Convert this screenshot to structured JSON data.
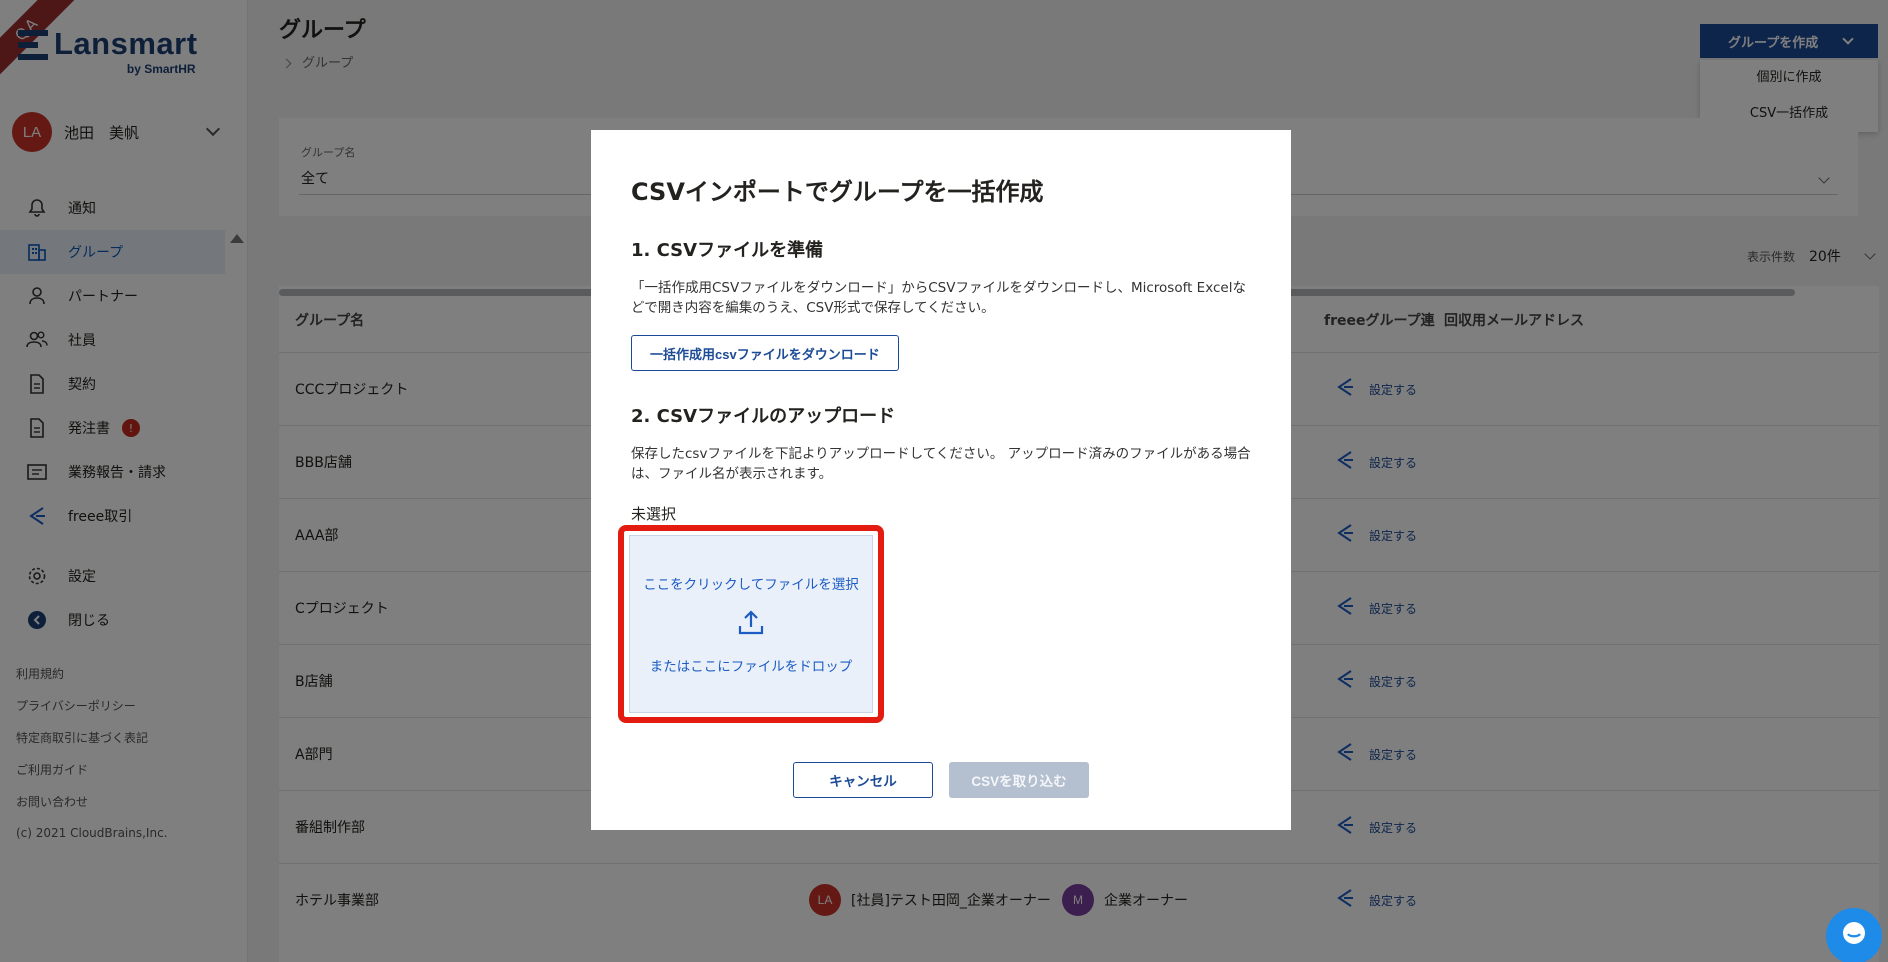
{
  "ribbon": "QA",
  "brand": {
    "name": "Lansmart",
    "sub": "by SmartHR",
    "color": "#1c3f74"
  },
  "user": {
    "initials": "LA",
    "name": "池田　美帆"
  },
  "nav": [
    {
      "label": "通知",
      "icon": "bell-icon"
    },
    {
      "label": "グループ",
      "icon": "building-icon",
      "active": true
    },
    {
      "label": "パートナー",
      "icon": "person-icon"
    },
    {
      "label": "社員",
      "icon": "people-icon"
    },
    {
      "label": "契約",
      "icon": "document-icon"
    },
    {
      "label": "発注書",
      "icon": "document-icon",
      "badge": "!"
    },
    {
      "label": "業務報告・請求",
      "icon": "folder-icon"
    },
    {
      "label": "freee取引",
      "icon": "freee-icon"
    },
    {
      "label": "設定",
      "icon": "gear-icon"
    },
    {
      "label": "閉じる",
      "icon": "collapse-icon"
    }
  ],
  "footer_links": [
    "利用規約",
    "プライバシーポリシー",
    "特定商取引に基づく表記",
    "ご利用ガイド",
    "お問い合わせ"
  ],
  "copyright": "(c) 2021 CloudBrains,Inc.",
  "page": {
    "title": "グループ",
    "breadcrumb": "グループ"
  },
  "create": {
    "label": "グループを作成",
    "options": [
      "個別に作成",
      "CSV一括作成"
    ]
  },
  "filter": {
    "label": "グループ名",
    "value": "全て"
  },
  "per_page": {
    "label": "表示件数",
    "value": "20件"
  },
  "table": {
    "headers": {
      "name": "グループ名",
      "freee": "freeeグループ連",
      "email": "回収用メールアドレス"
    },
    "set_label": "設定する",
    "rows": [
      {
        "name": "CCCプロジェクト"
      },
      {
        "name": "BBB店舗"
      },
      {
        "name": "AAA部"
      },
      {
        "name": "Cプロジェクト"
      },
      {
        "name": "B店舗"
      },
      {
        "name": "A部門"
      },
      {
        "name": "番組制作部"
      },
      {
        "name": "ホテル事業部",
        "members": [
          {
            "initials": "LA",
            "name": "[社員]テスト田岡_企業オーナー",
            "color": "#c9332b"
          },
          {
            "initials": "M",
            "name": "企業オーナー",
            "color": "#7b3f9e"
          }
        ]
      }
    ]
  },
  "modal": {
    "title": "CSVインポートでグループを一括作成",
    "step1_title": "1. CSVファイルを準備",
    "step1_text": "「一括作成用CSVファイルをダウンロード」からCSVファイルをダウンロードし、Microsoft Excelなどで開き内容を編集のうえ、CSV形式で保存してください。",
    "download_label": "一括作成用csvファイルをダウンロード",
    "step2_title": "2. CSVファイルのアップロード",
    "step2_text": "保存したcsvファイルを下記よりアップロードしてください。 アップロード済みのファイルがある場合は、ファイル名が表示されます。",
    "file_status": "未選択",
    "dropzone_click": "ここをクリックしてファイルを選択",
    "dropzone_drop": "またはここにファイルをドロップ",
    "cancel_label": "キャンセル",
    "import_label": "CSVを取り込む"
  }
}
